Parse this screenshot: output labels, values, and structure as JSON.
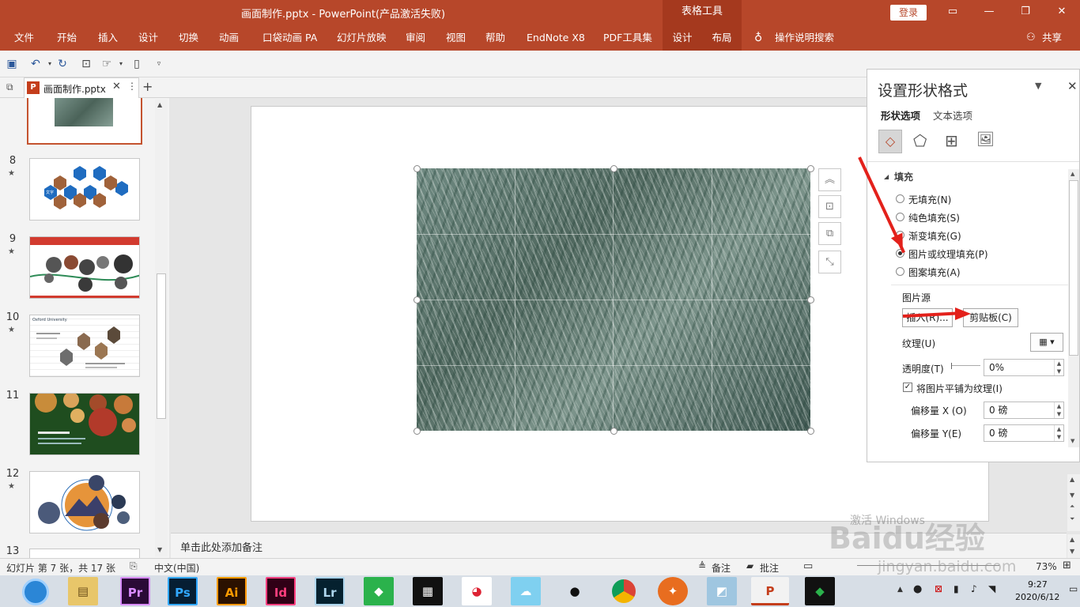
{
  "titlebar": {
    "title": "画面制作.pptx  -  PowerPoint(产品激活失败)",
    "context_tab": "表格工具",
    "login": "登录"
  },
  "ribbon_tabs": [
    "文件",
    "开始",
    "插入",
    "设计",
    "切换",
    "动画",
    "口袋动画 PA",
    "幻灯片放映",
    "审阅",
    "视图",
    "帮助",
    "EndNote X8",
    "PDF工具集",
    "设计",
    "布局"
  ],
  "tell_me": "操作说明搜索",
  "share": "共享",
  "document_tab": "画面制作.pptx",
  "thumbnails": [
    {
      "num": "8",
      "star": "★"
    },
    {
      "num": "9",
      "star": "★"
    },
    {
      "num": "10",
      "star": "★"
    },
    {
      "num": "11",
      "star": ""
    },
    {
      "num": "12",
      "star": "★"
    },
    {
      "num": "13",
      "star": ""
    }
  ],
  "thumb10_title": "Oxford University",
  "thumb8_label": "文字",
  "notes_placeholder": "单击此处添加备注",
  "format_pane": {
    "title": "设置形状格式",
    "tab_shape": "形状选项",
    "tab_text": "文本选项",
    "section_fill": "填充",
    "fill_options": [
      "无填充(N)",
      "纯色填充(S)",
      "渐变填充(G)",
      "图片或纹理填充(P)",
      "图案填充(A)"
    ],
    "selected_fill_index": 3,
    "picture_source": "图片源",
    "insert_button": "插入(R)...",
    "clipboard_button": "剪贴板(C)",
    "texture_label": "纹理(U)",
    "transparency_label": "透明度(T)",
    "transparency_value": "0%",
    "tile_checkbox": "将图片平铺为纹理(I)",
    "tile_checked": true,
    "offset_x_label": "偏移量 X (O)",
    "offset_x_value": "0 磅",
    "offset_y_label": "偏移量 Y(E)",
    "offset_y_value": "0 磅"
  },
  "statusbar": {
    "slide_info": "幻灯片 第 7 张，共 17 张",
    "language": "中文(中国)",
    "notes": "备注",
    "comments": "批注",
    "zoom": "73%"
  },
  "watermark": {
    "activate": "激活 Windows",
    "brand": "Baidu经验",
    "url": "jingyan.baidu.com"
  },
  "clock": {
    "time": "9:27",
    "date": "2020/6/12"
  },
  "taskbar_apps": [
    "Pr",
    "Ps",
    "Ai",
    "Id",
    "Lr"
  ],
  "colors": {
    "accent": "#b7472a",
    "annotation_arrow": "#e3211b"
  }
}
